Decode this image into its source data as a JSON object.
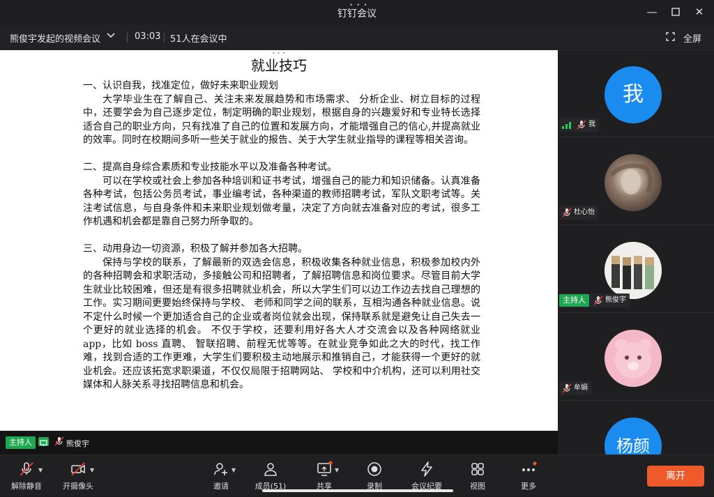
{
  "window": {
    "app_title": "钉钉会议",
    "minimize": "—",
    "maximize": "☐",
    "close": "✕"
  },
  "meeting_bar": {
    "meeting_name": "熊俊宇发起的视频会议",
    "dropdown": "∨",
    "duration": "03:03",
    "attendance": "51人在会议中",
    "fullscreen_label": "全屏"
  },
  "document": {
    "title": "就业技巧",
    "paragraphs": [
      {
        "kind": "heading",
        "text": "一、认识自我，找准定位，做好未来职业规划"
      },
      {
        "kind": "indent",
        "text": "大学毕业生在了解自己、关注未来发展趋势和市场需求、 分析企业、树立目标的过程中，还要学会为自己逐步定位，制定明确的职业规划，根据自身的兴趣爱好和专业特长选择适合自己的职业方向，只有找准了自己的位置和发展方向，才能增强自己的信心,并提高就业的效率。同时在校期间多听一些关于就业的报告、关于大学生就业指导的课程等相关咨询。"
      },
      {
        "kind": "gap",
        "text": ""
      },
      {
        "kind": "heading",
        "text": "二、提高自身综合素质和专业技能水平以及准备各种考试。"
      },
      {
        "kind": "indent",
        "text": "可以在学校或社会上参加各种培训和证书考试，增强自己的能力和知识储备。认真准备各种考试，包括公务员考试，事业编考试，各种渠道的教师招聘考试，军队文职考试等。关注考试信息，与自身条件和未来职业规划做考量，决定了方向就去准备对应的考试，很多工作机遇和机会都是靠自己努力所争取的。"
      },
      {
        "kind": "gap",
        "text": ""
      },
      {
        "kind": "heading",
        "text": "三、动用身边一切资源，积极了解并参加各大招聘。"
      },
      {
        "kind": "indent",
        "text": "保持与学校的联系，了解最新的双选会信息，积极收集各种就业信息，积极参加校内外的各种招聘会和求职活动，多接触公司和招聘者，了解招聘信息和岗位要求。尽管目前大学生就业比较困难，但还是有很多招聘就业机会，所以大学生们可以边工作边去找自己理想的工作。实习期间更要始终保持与学校、 老师和同学之间的联系，互相沟通各种就业信息。说不定什么时候一个更加适合自己的企业或者岗位就会出现，保持联系就是避免让自己失去一个更好的就业选择的机会。 不仅于学校，还要利用好各大人才交流会以及各种网络就业 app，比如 boss 直聘、 智联招聘、前程无忧等等。在就业竞争如此之大的时代，找工作难，找到合适的工作更难，大学生们要积极主动地展示和推销自己，才能获得一个更好的就业机会。还应该拓宽求职渠道，不仅仅局限于招聘网站、 学校和中介机构，还可以利用社交媒体和人脉关系寻找招聘信息和机会。"
      }
    ]
  },
  "share_bar": {
    "host_badge": "主持人",
    "sharer_name": "熊俊宇"
  },
  "participants": [
    {
      "avatar_text": "我",
      "name": "我",
      "host": false,
      "signal": true,
      "avatar": "text"
    },
    {
      "avatar_text": "",
      "name": "杜心怡",
      "host": false,
      "signal": false,
      "avatar": "photo-brown"
    },
    {
      "avatar_text": "",
      "name": "熊俊宇",
      "host": true,
      "host_label": "主持人",
      "signal": false,
      "avatar": "photo-group"
    },
    {
      "avatar_text": "",
      "name": "牟娟",
      "host": false,
      "signal": false,
      "avatar": "photo-pink-bear"
    },
    {
      "avatar_text": "杨颜",
      "name": "",
      "host": false,
      "signal": false,
      "avatar": "text"
    }
  ],
  "toolbar": {
    "items": [
      {
        "label": "解除静音",
        "icon": "mic-muted-icon"
      },
      {
        "label": "开摄像头",
        "icon": "camera-off-icon"
      },
      {
        "label": "邀请",
        "icon": "invite-icon"
      },
      {
        "label": "成员(51)",
        "icon": "members-icon"
      },
      {
        "label": "共享",
        "icon": "share-screen-icon"
      },
      {
        "label": "录制",
        "icon": "record-icon"
      },
      {
        "label": "会议纪要",
        "icon": "minutes-icon"
      },
      {
        "label": "视图",
        "icon": "grid-view-icon"
      },
      {
        "label": "更多",
        "icon": "more-icon"
      }
    ],
    "leave_label": "离开"
  },
  "colors": {
    "accent_blue": "#1a8cf0",
    "host_green": "#1ea851",
    "leave_orange": "#ef5a2a",
    "mute_red": "#e8453c"
  }
}
